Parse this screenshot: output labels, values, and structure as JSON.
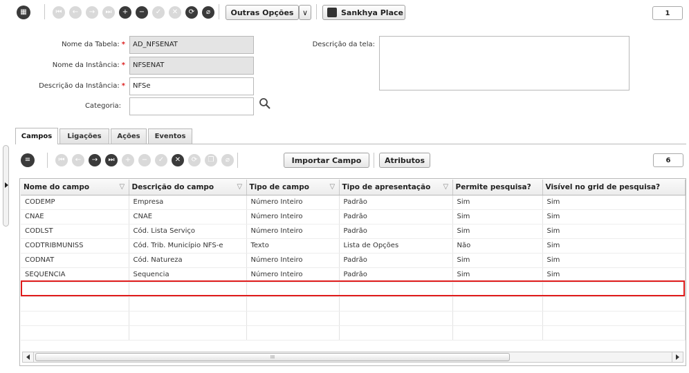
{
  "toolbar": {
    "outras_opcoes": "Outras Opções",
    "dropdown_glyph": "∨",
    "sankhya_place": "Sankhya Place",
    "counter": "1"
  },
  "form": {
    "nome_tabela_label": "Nome da Tabela:",
    "nome_tabela_value": "AD_NFSENAT",
    "nome_instancia_label": "Nome da Instância:",
    "nome_instancia_value": "NFSENAT",
    "descricao_instancia_label": "Descrição da Instância:",
    "descricao_instancia_value": "NFSe",
    "categoria_label": "Categoria:",
    "categoria_value": "",
    "descricao_tela_label": "Descrição da tela:",
    "descricao_tela_value": "",
    "required_mark": "*"
  },
  "tabs": [
    "Campos",
    "Ligações",
    "Ações",
    "Eventos"
  ],
  "grid_toolbar": {
    "importar_campo": "Importar Campo",
    "atributos": "Atributos",
    "counter": "6"
  },
  "grid": {
    "columns": [
      "Nome do campo",
      "Descrição do campo",
      "Tipo de campo",
      "Tipo de apresentação",
      "Permite pesquisa?",
      "Visível no grid de pesquisa?"
    ],
    "rows": [
      [
        "CODEMP",
        "Empresa",
        "Número Inteiro",
        "Padrão",
        "Sim",
        "Sim"
      ],
      [
        "CNAE",
        "CNAE",
        "Número Inteiro",
        "Padrão",
        "Sim",
        "Sim"
      ],
      [
        "CODLST",
        "Cód. Lista Serviço",
        "Número Inteiro",
        "Padrão",
        "Sim",
        "Sim"
      ],
      [
        "CODTRIBMUNISS",
        "Cód. Trib. Município NFS-e",
        "Texto",
        "Lista de Opções",
        "Não",
        "Sim"
      ],
      [
        "CODNAT",
        "Cód. Natureza",
        "Número Inteiro",
        "Padrão",
        "Sim",
        "Sim"
      ],
      [
        "SEQUENCIA",
        "Sequencia",
        "Número Inteiro",
        "Padrão",
        "Sim",
        "Sim"
      ]
    ],
    "highlighted_row": 5,
    "empty_rows": 4
  },
  "scroll": {
    "grip": "III"
  },
  "colors": {
    "highlight": "#e01b1b",
    "required": "#d22222"
  }
}
